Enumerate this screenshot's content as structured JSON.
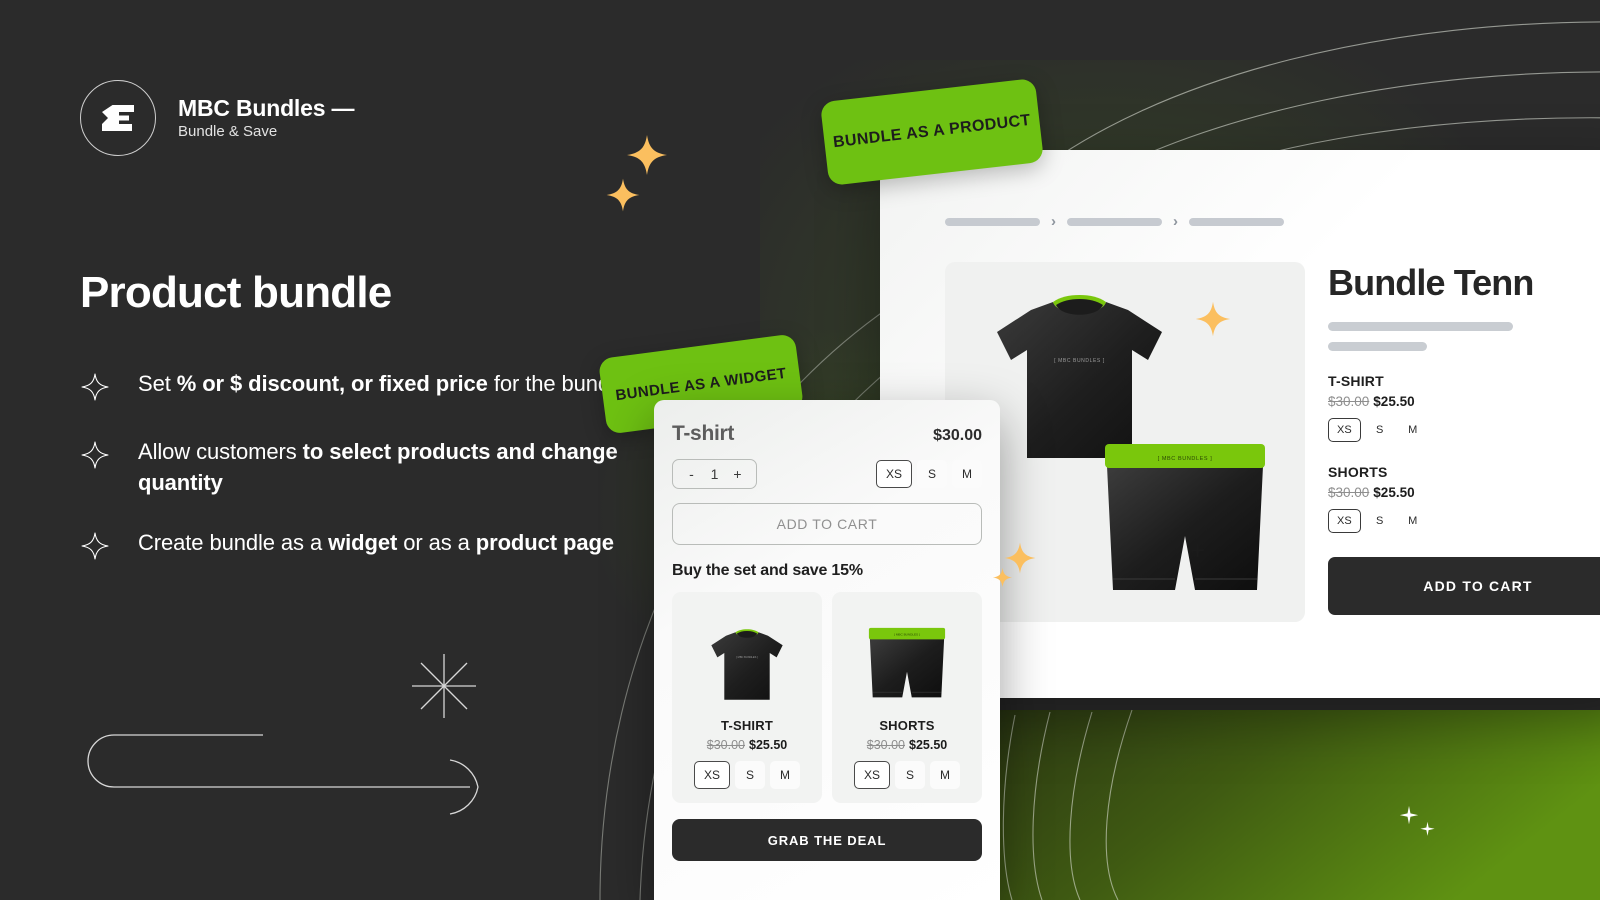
{
  "brand": {
    "logo_icon": "mbc-logo-icon",
    "title": "MBC Bundles —",
    "subtitle": "Bundle & Save"
  },
  "hero": {
    "headline": "Product bundle",
    "features": [
      {
        "icon": "sparkle-icon",
        "parts": [
          {
            "text": "Set ",
            "bold": false
          },
          {
            "text": "% or $ discount, or fixed price",
            "bold": true
          },
          {
            "text": " for the bundle",
            "bold": false
          }
        ]
      },
      {
        "icon": "sparkle-icon",
        "parts": [
          {
            "text": "Allow customers ",
            "bold": false
          },
          {
            "text": "to select products and change quantity",
            "bold": true
          }
        ]
      },
      {
        "icon": "sparkle-icon",
        "parts": [
          {
            "text": "Create bundle as a ",
            "bold": false
          },
          {
            "text": "widget",
            "bold": true
          },
          {
            "text": " or as a ",
            "bold": false
          },
          {
            "text": "product page",
            "bold": true
          }
        ]
      }
    ]
  },
  "badges": {
    "product": "BUNDLE AS A PRODUCT",
    "widget": "BUNDLE AS A WIDGET"
  },
  "product_page": {
    "breadcrumb": {
      "crumbs": 3,
      "separator_icon": "chevron-right-icon"
    },
    "gallery": {
      "plus_icon": "plus-icon",
      "items": [
        {
          "name": "t-shirt-image",
          "print": "[ MBC BUNDLES ]"
        },
        {
          "name": "shorts-image",
          "print": "[ MBC BUNDLES ]"
        }
      ]
    },
    "title": "Bundle Tenn",
    "placeholder_lines": 2,
    "items": [
      {
        "name": "T-SHIRT",
        "old_price": "$30.00",
        "new_price": "$25.50",
        "sizes": [
          "XS",
          "S",
          "M"
        ],
        "selected_size": "XS"
      },
      {
        "name": "SHORTS",
        "old_price": "$30.00",
        "new_price": "$25.50",
        "sizes": [
          "XS",
          "S",
          "M"
        ],
        "selected_size": "XS"
      }
    ],
    "cta": "ADD TO CART"
  },
  "widget": {
    "product_name": "T-shirt",
    "price": "$30.00",
    "quantity": {
      "minus": "-",
      "value": "1",
      "plus": "+"
    },
    "sizes": [
      "XS",
      "S",
      "M"
    ],
    "selected_size": "XS",
    "add_to_cart": "ADD TO CART",
    "offer_heading": "Buy the set and save 15%",
    "products": [
      {
        "name": "T-SHIRT",
        "old_price": "$30.00",
        "new_price": "$25.50",
        "sizes": [
          "XS",
          "S",
          "M"
        ],
        "selected_size": "XS",
        "image": "t-shirt-image"
      },
      {
        "name": "SHORTS",
        "old_price": "$30.00",
        "new_price": "$25.50",
        "sizes": [
          "XS",
          "S",
          "M"
        ],
        "selected_size": "XS",
        "image": "shorts-image"
      }
    ],
    "deal_button": "GRAB THE DEAL"
  },
  "decor": {
    "sparkle_icon": "sparkle-icon",
    "burst_icon": "starburst-icon",
    "arrow_icon": "curved-arrow-icon",
    "small_plus_icon": "small-plus-sparkle-icon"
  },
  "colors": {
    "background": "#2b2b2b",
    "accent_green": "#6ec112",
    "accent_orange": "#fbbf5f",
    "dark_button": "#2b2b2b",
    "panel_white": "#ffffff"
  }
}
